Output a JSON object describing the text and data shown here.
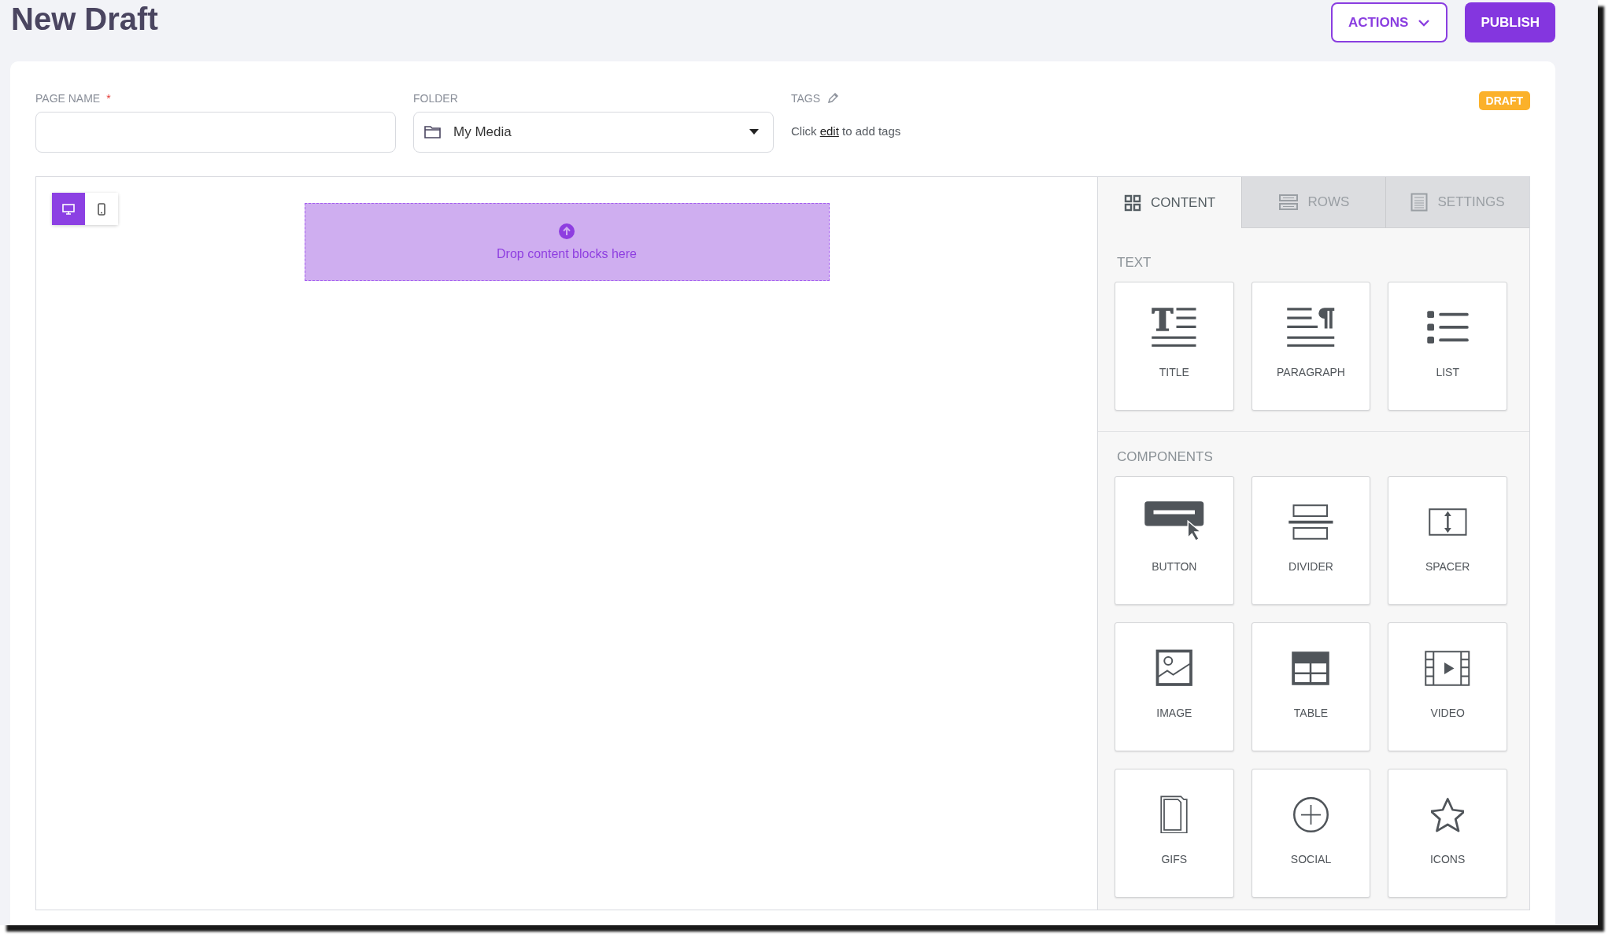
{
  "page": {
    "title": "New Draft"
  },
  "header_buttons": [
    {
      "label": "ACTIONS",
      "kind": "outline"
    },
    {
      "label": "PUBLISH",
      "kind": "primary"
    }
  ],
  "form": {
    "page_name": {
      "label": "PAGE NAME",
      "required_mark": "*"
    },
    "folder": {
      "label": "FOLDER",
      "value": "My Media"
    },
    "tags": {
      "label": "TAGS",
      "hint_before": "Click",
      "hint_link": "edit",
      "hint_after": "to add tags"
    },
    "status_badge": "DRAFT"
  },
  "device_toggle": [
    {
      "kind": "desktop",
      "selected": true
    },
    {
      "kind": "mobile",
      "selected": false
    }
  ],
  "drop_zone": {
    "text": "Drop content blocks here"
  },
  "panel_tabs": [
    {
      "label": "CONTENT",
      "kind": "content",
      "selected": true
    },
    {
      "label": "ROWS",
      "kind": "rows",
      "selected": false
    },
    {
      "label": "SETTINGS",
      "kind": "settings",
      "selected": false
    }
  ],
  "sections": [
    {
      "title": "TEXT",
      "blocks": [
        {
          "label": "TITLE",
          "kind": "title"
        },
        {
          "label": "PARAGRAPH",
          "kind": "paragraph"
        },
        {
          "label": "LIST",
          "kind": "list"
        }
      ]
    },
    {
      "title": "COMPONENTS",
      "blocks": [
        {
          "label": "BUTTON",
          "kind": "button"
        },
        {
          "label": "DIVIDER",
          "kind": "divider"
        },
        {
          "label": "SPACER",
          "kind": "spacer"
        },
        {
          "label": "IMAGE",
          "kind": "image"
        },
        {
          "label": "TABLE",
          "kind": "table"
        },
        {
          "label": "VIDEO",
          "kind": "video"
        },
        {
          "label": "GIFS",
          "kind": "gifs"
        },
        {
          "label": "SOCIAL",
          "kind": "social"
        },
        {
          "label": "ICONS",
          "kind": "icons"
        }
      ]
    }
  ]
}
